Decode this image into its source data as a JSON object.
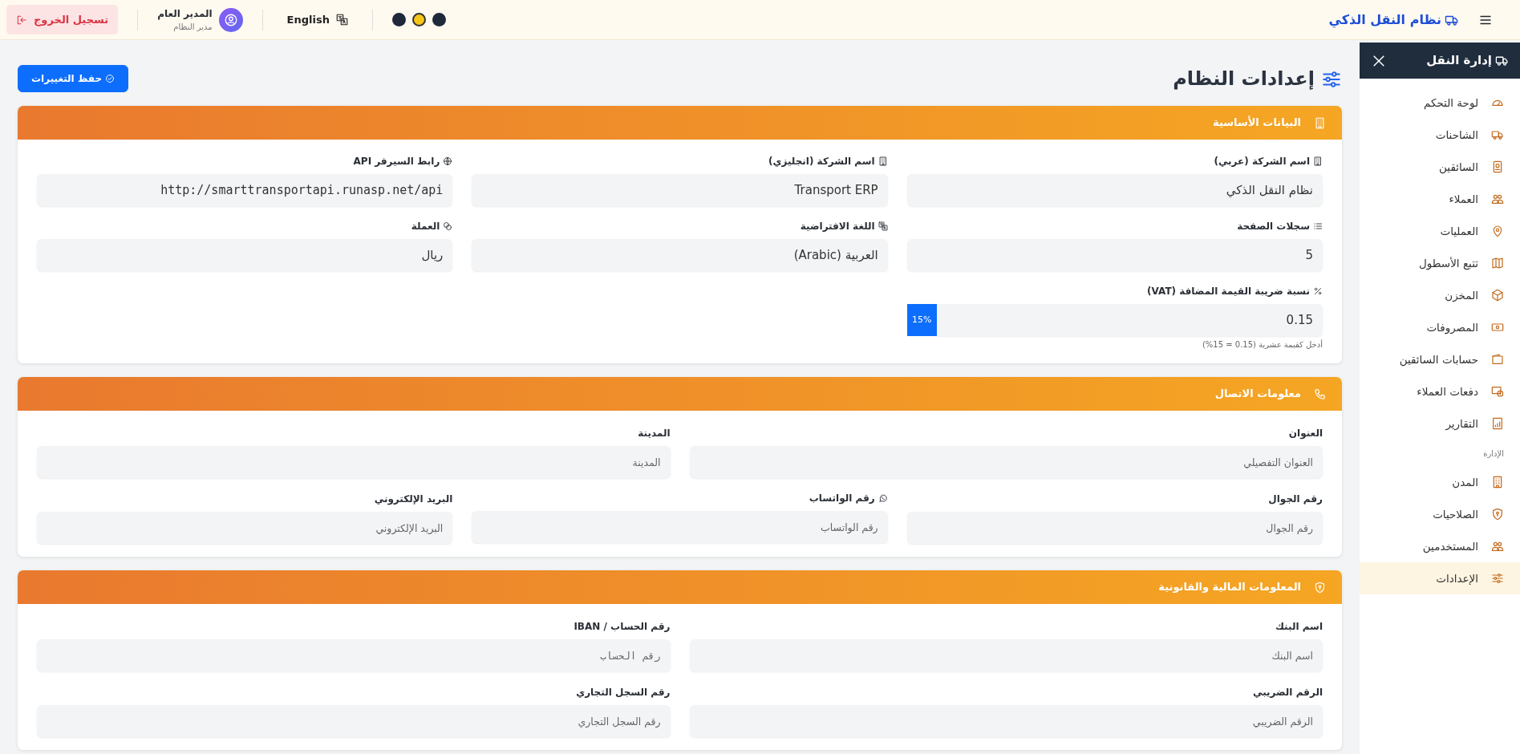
{
  "topbar": {
    "brand": "نظام النقل الذكي",
    "theme_options": [
      {
        "color": "#1e293b",
        "selected": false
      },
      {
        "color": "#f5c518",
        "selected": true
      },
      {
        "color": "#1e293b",
        "selected": false
      }
    ],
    "language": "English",
    "user": {
      "name": "المدير العام",
      "role": "مدير النظام"
    },
    "logout": "تسجيل الخروج"
  },
  "sidebar": {
    "title": "إدارة النقل",
    "items": [
      {
        "label": "لوحة التحكم",
        "selected": false
      },
      {
        "label": "الشاحنات",
        "selected": false
      },
      {
        "label": "السائقين",
        "selected": false
      },
      {
        "label": "العملاء",
        "selected": false
      },
      {
        "label": "العمليات",
        "selected": false
      },
      {
        "label": "تتبع الأسطول",
        "selected": false
      },
      {
        "label": "المخزن",
        "selected": false
      },
      {
        "label": "المصروفات",
        "selected": false
      },
      {
        "label": "حسابات السائقين",
        "selected": false
      },
      {
        "label": "دفعات العملاء",
        "selected": false
      },
      {
        "label": "التقارير",
        "selected": false
      }
    ],
    "section_label": "الإدارة",
    "admin_items": [
      {
        "label": "المدن",
        "selected": false
      },
      {
        "label": "الصلاحيات",
        "selected": false
      },
      {
        "label": "المستخدمين",
        "selected": false
      },
      {
        "label": "الإعدادات",
        "selected": true
      }
    ]
  },
  "page": {
    "title": "إعدادات النظام",
    "save_button": "حفظ التغييرات"
  },
  "sections": [
    {
      "title": "البيانات الأساسية",
      "rows": [
        [
          {
            "label": "اسم الشركة (عربي)",
            "kind": "text",
            "value": "نظام النقل الذكي"
          },
          {
            "label": "اسم الشركة (انجليزي)",
            "kind": "text",
            "value": "Transport ERP"
          },
          {
            "label": "رابط السيرفر API",
            "kind": "text",
            "value": "http://smarttransportapi.runasp.net/api",
            "mono": true
          }
        ],
        [
          {
            "label": "سجلات الصفحة",
            "kind": "select",
            "value": "5"
          },
          {
            "label": "اللغة الافتراضية",
            "kind": "select",
            "value": "العربية (Arabic)"
          },
          {
            "label": "العملة",
            "kind": "text",
            "value": "ريال"
          }
        ],
        [
          {
            "label": "نسبة ضريبة القيمة المضافة (VAT)",
            "kind": "addon",
            "value": "0.15",
            "addon": "15%",
            "help": "أدخل كقيمة عشرية (0.15 = 15%)"
          }
        ]
      ]
    },
    {
      "title": "معلومات الاتصال",
      "rows": [
        [
          {
            "label": "العنوان",
            "kind": "text",
            "placeholder": "العنوان التفصيلي"
          },
          {
            "label": "المدينة",
            "kind": "text",
            "placeholder": "المدينة"
          }
        ],
        [
          {
            "label": "رقم الجوال",
            "kind": "text",
            "placeholder": "رقم الجوال"
          },
          {
            "label": "رقم الواتساب",
            "kind": "text",
            "placeholder": "رقم الواتساب"
          },
          {
            "label": "البريد الإلكتروني",
            "kind": "text",
            "placeholder": "البريد الإلكتروني"
          }
        ]
      ]
    },
    {
      "title": "المعلومات المالية والقانونية",
      "rows": [
        [
          {
            "label": "اسم البنك",
            "kind": "text",
            "placeholder": "اسم البنك"
          },
          {
            "label": "رقم الحساب / IBAN",
            "kind": "text",
            "placeholder": "رقم الحساب",
            "mono": true
          }
        ],
        [
          {
            "label": "الرقم الضريبي",
            "kind": "text",
            "placeholder": "الرقم الضريبي"
          },
          {
            "label": "رقم السجل التجاري",
            "kind": "text",
            "placeholder": "رقم السجل التجاري"
          }
        ]
      ]
    }
  ]
}
